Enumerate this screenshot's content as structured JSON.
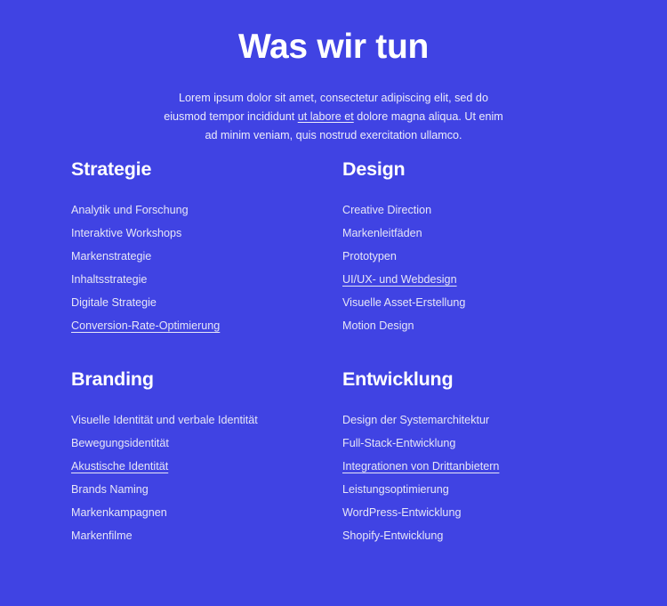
{
  "theme": {
    "background": "#4043e3",
    "heading_color": "#ffffff",
    "body_text_color": "#e6e6f7"
  },
  "hero": {
    "title": "Was wir tun",
    "paragraph_part1": "Lorem ipsum dolor sit amet, consectetur adipiscing elit, sed do eiusmod tempor incididunt ",
    "paragraph_link": "ut labore et",
    "paragraph_part2": " dolore magna aliqua. Ut enim ad minim veniam, quis nostrud exercitation ullamco."
  },
  "columns": [
    {
      "heading": "Strategie",
      "items": [
        {
          "label": "Analytik und Forschung",
          "is_link": false
        },
        {
          "label": "Interaktive Workshops",
          "is_link": false
        },
        {
          "label": "Markenstrategie",
          "is_link": false
        },
        {
          "label": "Inhaltsstrategie",
          "is_link": false
        },
        {
          "label": "Digitale Strategie",
          "is_link": false
        },
        {
          "label": "Conversion-Rate-Optimierung",
          "is_link": true
        }
      ]
    },
    {
      "heading": "Design",
      "items": [
        {
          "label": "Creative Direction",
          "is_link": false
        },
        {
          "label": "Markenleitfäden",
          "is_link": false
        },
        {
          "label": "Prototypen",
          "is_link": false
        },
        {
          "label": "UI/UX- und Webdesign ",
          "is_link": true
        },
        {
          "label": "Visuelle Asset-Erstellung",
          "is_link": false
        },
        {
          "label": "Motion Design",
          "is_link": false
        }
      ]
    },
    {
      "heading": "Branding",
      "items": [
        {
          "label": "Visuelle Identität und verbale Identität",
          "is_link": false
        },
        {
          "label": "Bewegungsidentität",
          "is_link": false
        },
        {
          "label": "Akustische Identität",
          "is_link": true
        },
        {
          "label": "Brands Naming",
          "is_link": false
        },
        {
          "label": "Markenkampagnen",
          "is_link": false
        },
        {
          "label": "Markenfilme",
          "is_link": false
        }
      ]
    },
    {
      "heading": "Entwicklung",
      "items": [
        {
          "label": "Design der Systemarchitektur",
          "is_link": false
        },
        {
          "label": "Full-Stack-Entwicklung",
          "is_link": false
        },
        {
          "label": "Integrationen von Drittanbietern ",
          "is_link": true
        },
        {
          "label": "Leistungsoptimierung",
          "is_link": false
        },
        {
          "label": "WordPress-Entwicklung",
          "is_link": false
        },
        {
          "label": "Shopify-Entwicklung",
          "is_link": false
        }
      ]
    }
  ]
}
